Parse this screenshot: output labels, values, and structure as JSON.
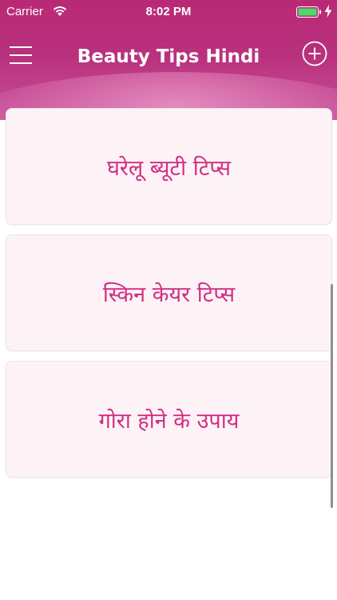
{
  "status_bar": {
    "carrier": "Carrier",
    "time": "8:02 PM"
  },
  "header": {
    "title": "Beauty Tips Hindi",
    "menu_icon": "hamburger-menu-icon",
    "add_icon": "plus-circle-icon"
  },
  "categories": [
    {
      "label": "घरेलू ब्यूटी टिप्स"
    },
    {
      "label": "स्किन केयर टिप्स"
    },
    {
      "label": "गोरा होने के उपाय"
    }
  ],
  "colors": {
    "header": "#b92a76",
    "card_background": "#fdf3f7",
    "card_text": "#d22d82",
    "battery": "#4cd964"
  }
}
